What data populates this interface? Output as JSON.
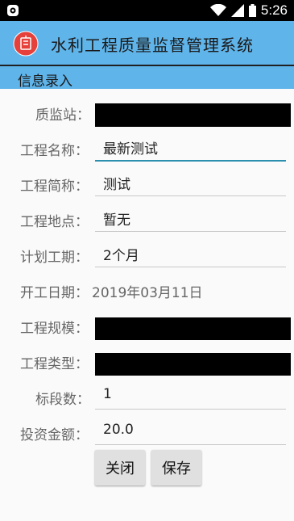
{
  "status_bar": {
    "time": "5:26"
  },
  "app_bar": {
    "title": "水利工程质量监督管理系统"
  },
  "section": {
    "title": "信息录入"
  },
  "form": {
    "quality_station": {
      "label": "质监站：",
      "value": ""
    },
    "project_name": {
      "label": "工程名称：",
      "value": "最新测试"
    },
    "project_abbr": {
      "label": "工程简称：",
      "value": "测试"
    },
    "project_location": {
      "label": "工程地点：",
      "value": "暂无"
    },
    "planned_duration": {
      "label": "计划工期：",
      "value": "2个月"
    },
    "start_date": {
      "label": "开工日期：",
      "value": "2019年03月11日"
    },
    "project_scale": {
      "label": "工程规模：",
      "value": ""
    },
    "project_type": {
      "label": "工程类型：",
      "value": ""
    },
    "section_count": {
      "label": "标段数：",
      "value": "1"
    },
    "investment": {
      "label": "投资金额：",
      "value": "20.0"
    }
  },
  "buttons": {
    "close": "关闭",
    "save": "保存"
  },
  "colors": {
    "app_bar": "#5fb4ea",
    "focus_underline": "#2b8fb0",
    "logo": "#e5413a"
  }
}
